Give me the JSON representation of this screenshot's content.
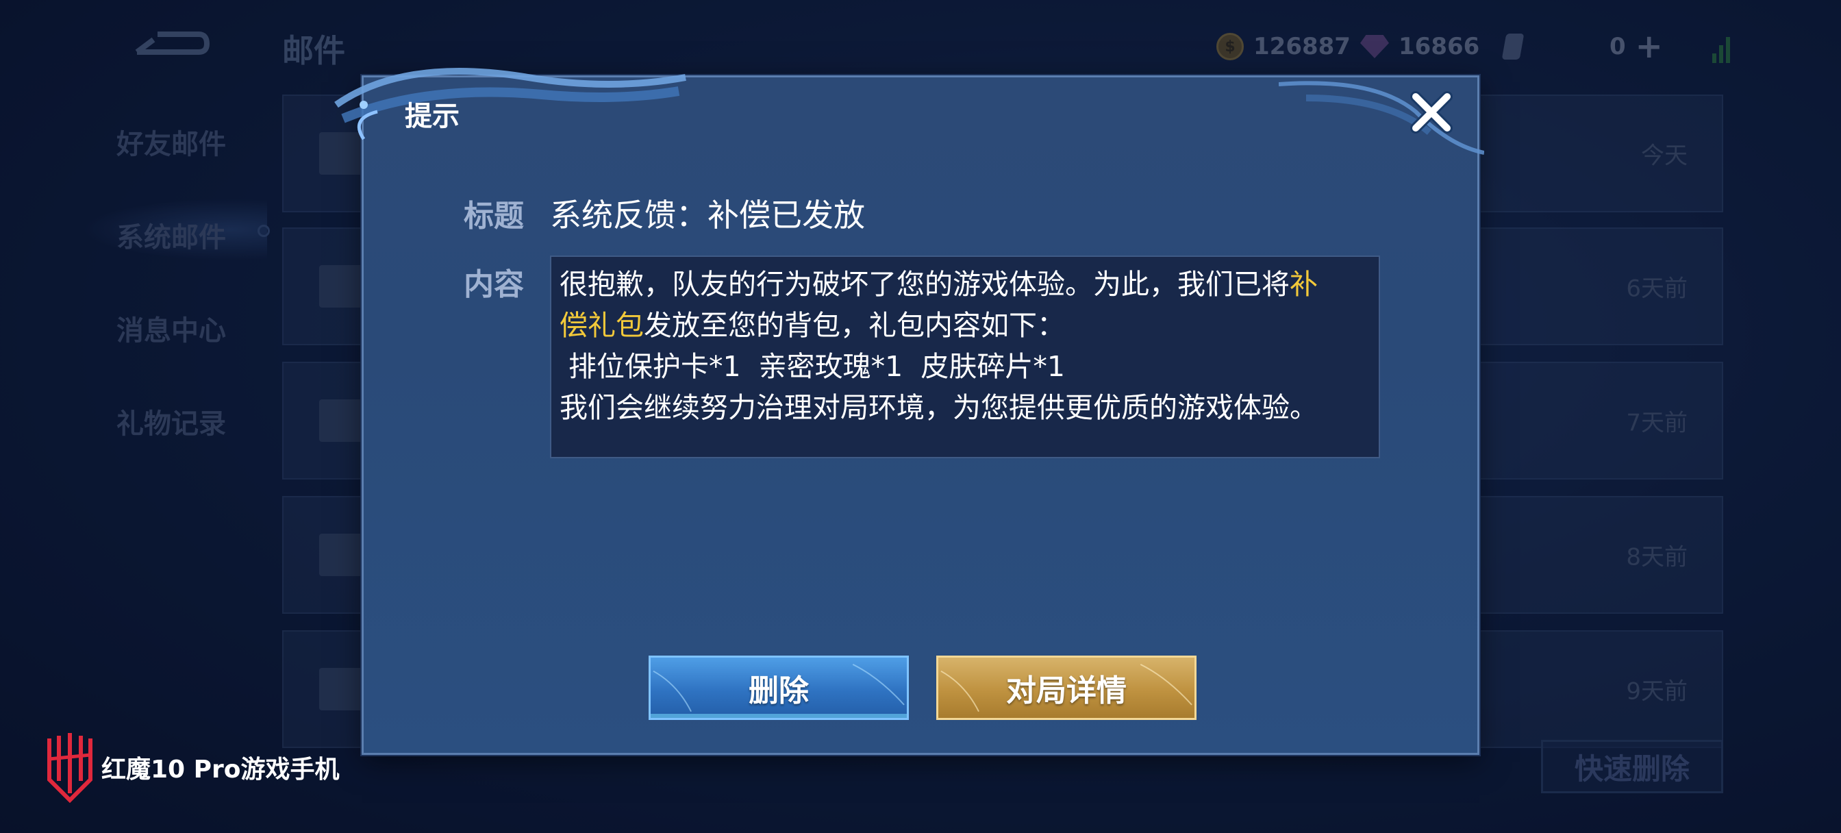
{
  "background": {
    "title": "邮件",
    "currency": {
      "gold": "126887",
      "gems": "16866",
      "tickets": "0"
    },
    "sidebar": [
      {
        "label": "好友邮件"
      },
      {
        "label": "系统邮件"
      },
      {
        "label": "消息中心"
      },
      {
        "label": "礼物记录"
      }
    ],
    "mail_times": [
      "今天",
      "6天前",
      "7天前",
      "8天前",
      "9天前"
    ],
    "quick_delete_label": "快速删除"
  },
  "dialog": {
    "title": "提示",
    "subject_label": "标题",
    "subject": "系统反馈：补偿已发放",
    "content_label": "内容",
    "content": {
      "line1_pre": "很抱歉，队友的行为破坏了您的游戏体验。为此，我们已将",
      "line1_highlight": "补",
      "line2_highlight": "偿礼包",
      "line2_post": "发放至您的背包，礼包内容如下：",
      "line3": " 排位保护卡*1  亲密玫瑰*1  皮肤碎片*1",
      "line4": "我们会继续努力治理对局环境，为您提供更优质的游戏体验。"
    },
    "delete_label": "删除",
    "detail_label": "对局详情"
  },
  "watermark": {
    "text": "红魔10 Pro游戏手机"
  },
  "colors": {
    "highlight": "#f2c93a",
    "delete_button": "#2f73c2",
    "detail_button": "#bf9240",
    "dialog_bg": "#2a4a78",
    "content_bg": "#18284a"
  },
  "icons": [
    "back-icon",
    "gold-coin-icon",
    "gem-icon",
    "ticket-icon",
    "plus-icon",
    "signal-icon",
    "close-icon",
    "envelope-icon",
    "red-magic-logo"
  ]
}
